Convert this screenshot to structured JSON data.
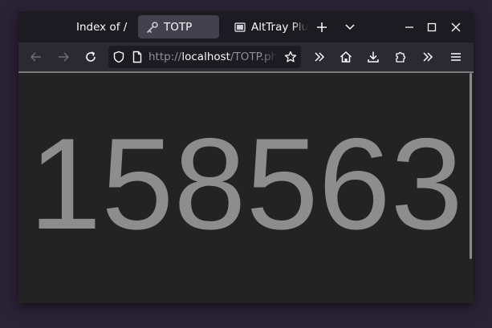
{
  "tabs": [
    {
      "label": "Index of /",
      "icon": "none",
      "active": false
    },
    {
      "label": "TOTP",
      "icon": "key-icon",
      "active": true
    },
    {
      "label": "AltTray Plu",
      "icon": "image-icon",
      "active": false
    }
  ],
  "urlbar": {
    "scheme": "http://",
    "host": "localhost",
    "path": "/TOTP.ph"
  },
  "page": {
    "code": "158563"
  },
  "colors": {
    "tabstrip": "#1c1b22",
    "toolbar": "#2b2a33",
    "active_tab": "#42414d",
    "content": "#232323",
    "code_text": "#8d8d8d"
  }
}
